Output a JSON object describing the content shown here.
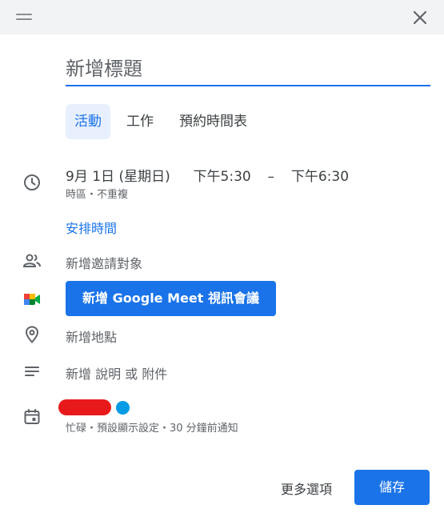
{
  "header": {
    "drag_icon": "drag-handle-icon",
    "close_icon": "close-icon"
  },
  "title": {
    "placeholder": "新增標題"
  },
  "tabs": [
    {
      "label": "活動"
    },
    {
      "label": "工作"
    },
    {
      "label": "預約時間表"
    }
  ],
  "datetime": {
    "date": "9月 1日 (星期日)",
    "start": "下午5:30",
    "separator": "–",
    "end": "下午6:30",
    "sub": "時區・不重複"
  },
  "schedule_link": "安排時間",
  "guests_label": "新增邀請對象",
  "meet_button": "新增 Google Meet 視訊會議",
  "location_label": "新增地點",
  "description_label": "新增 說明 或 附件",
  "calendar": {
    "calendar_color": "#039be5",
    "details": "忙碌・預設顯示設定・30 分鐘前通知"
  },
  "footer": {
    "more_options": "更多選項",
    "save": "儲存"
  },
  "colors": {
    "accent": "#1a73e8",
    "topbar": "#f1f3f4",
    "redaction": "#e8191b"
  }
}
